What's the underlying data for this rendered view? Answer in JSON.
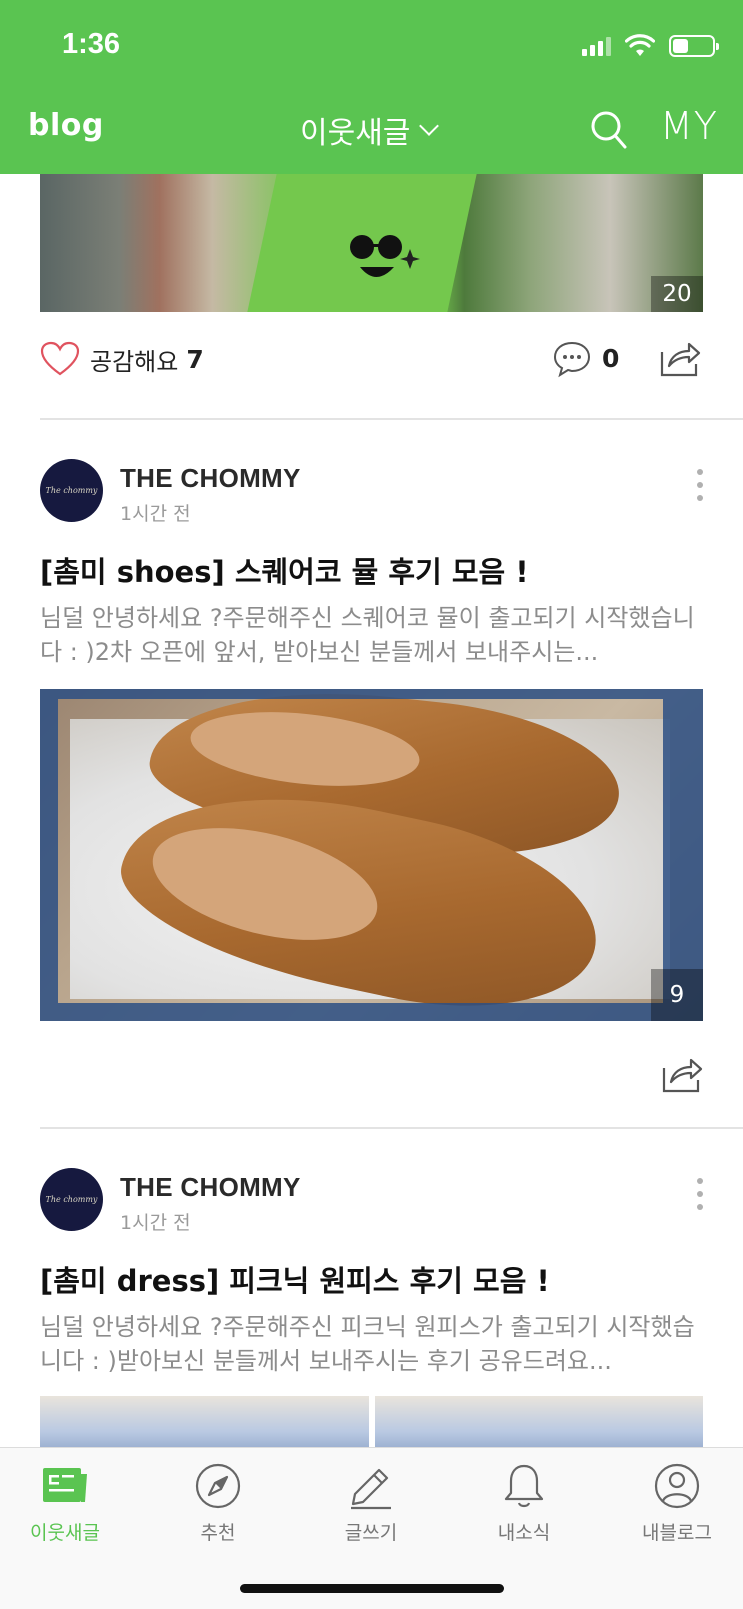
{
  "status_bar": {
    "time": "1:36"
  },
  "header": {
    "logo": "blog",
    "title": "이웃새글",
    "my_label": "MY"
  },
  "prev_post": {
    "photo_count": "20",
    "like_label": "공감해요",
    "like_count": "7",
    "comment_count": "0"
  },
  "posts": [
    {
      "avatar_text": "The chommy",
      "author": "THE CHOMMY",
      "time": "1시간 전",
      "title": "[촘미 shoes] 스퀘어코 뮬 후기 모음 !",
      "excerpt": "님덜 안녕하세요 ?주문해주신 스퀘어코 뮬이 출고되기 시작했습니다 : )2차 오픈에 앞서, 받아보신 분들께서 보내주시는...",
      "photo_count": "9"
    },
    {
      "avatar_text": "The chommy",
      "author": "THE CHOMMY",
      "time": "1시간 전",
      "title": "[촘미 dress] 피크닉 원피스 후기 모음 !",
      "excerpt": "님덜 안녕하세요 ?주문해주신 피크닉 원피스가 출고되기 시작했습니다 : )받아보신 분들께서 보내주시는 후기 공유드려요..."
    }
  ],
  "tabs": [
    {
      "label": "이웃새글",
      "icon": "news-feed-icon",
      "active": true
    },
    {
      "label": "추천",
      "icon": "compass-icon"
    },
    {
      "label": "글쓰기",
      "icon": "pencil-icon"
    },
    {
      "label": "내소식",
      "icon": "bell-icon"
    },
    {
      "label": "내블로그",
      "icon": "profile-icon"
    }
  ],
  "colors": {
    "brand_green": "#5ac451",
    "avatar_navy": "#16193f"
  }
}
